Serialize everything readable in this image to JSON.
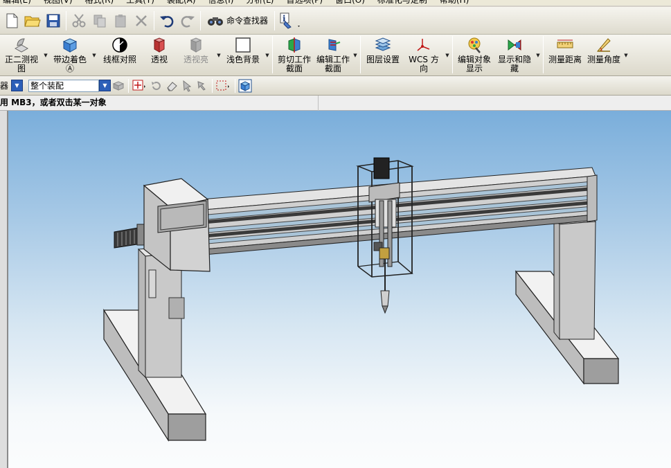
{
  "menubar": {
    "items": [
      "编辑(E)",
      "视图(V)",
      "格式(R)",
      "工具(T)",
      "装配(A)",
      "信息(I)",
      "分析(L)",
      "首选项(P)",
      "窗口(O)",
      "标准化与定制",
      "帮助(H)"
    ]
  },
  "toolbar1": {
    "command_finder_label": "命令查找器"
  },
  "toolbar2": {
    "buttons": [
      {
        "label": "正二测视\n图",
        "disabled": false
      },
      {
        "label": "带边着色\nⒶ",
        "disabled": false
      },
      {
        "label": "线框对照",
        "disabled": false
      },
      {
        "label": "透视",
        "disabled": false
      },
      {
        "label": "透视亮",
        "disabled": true
      },
      {
        "label": "浅色背景",
        "disabled": false
      },
      {
        "label": "剪切工作\n截面",
        "disabled": false
      },
      {
        "label": "编辑工作\n截面",
        "disabled": false
      },
      {
        "label": "图层设置",
        "disabled": false
      },
      {
        "label": "WCS 方向",
        "disabled": false
      },
      {
        "label": "编辑对象\n显示",
        "disabled": false
      },
      {
        "label": "显示和隐\n藏",
        "disabled": false
      },
      {
        "label": "测量距离",
        "disabled": false
      },
      {
        "label": "测量角度",
        "disabled": false
      }
    ]
  },
  "toolbar3": {
    "filter_label": "器",
    "scope_value": "整个装配"
  },
  "cuebar": {
    "text": "用 MB3，或者双击某一对象"
  },
  "colors": {
    "accent": "#2c5fb8",
    "sky_top": "#7aaedb",
    "model_gray": "#c8c8c8",
    "model_blue_strip": "#a9c4d8"
  }
}
